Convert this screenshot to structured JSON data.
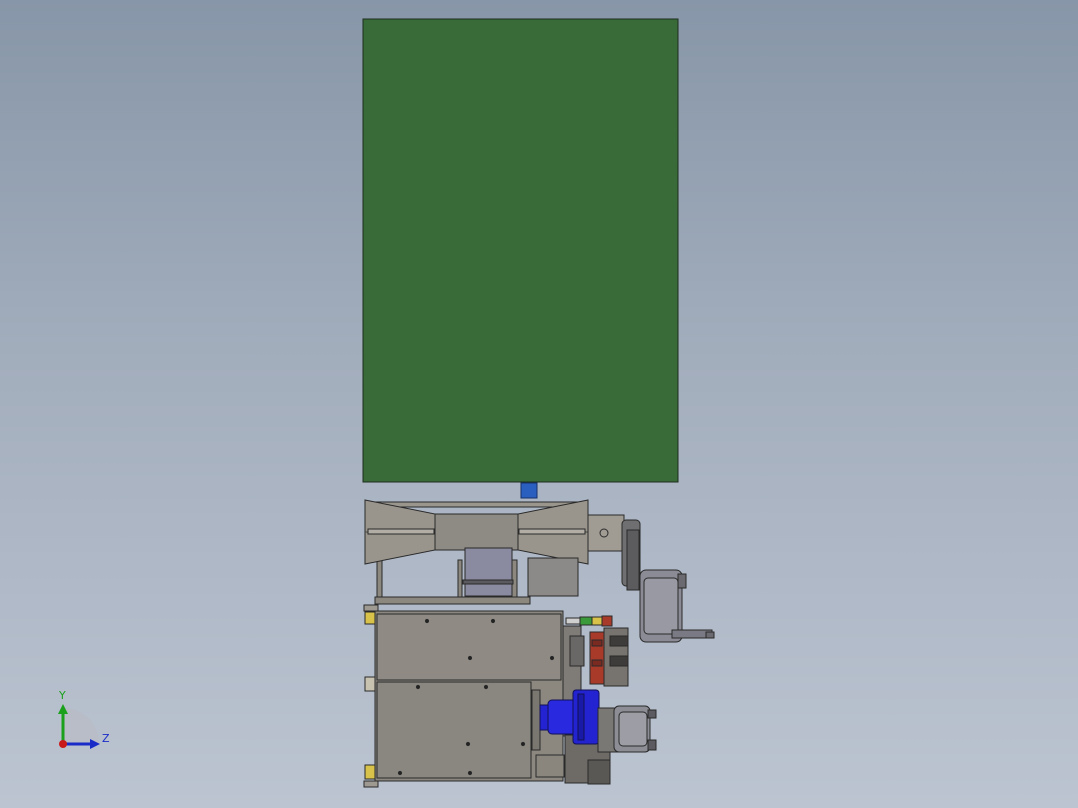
{
  "view": {
    "background_top": "#8796a8",
    "background_bottom": "#bcc4d1"
  },
  "model": {
    "panel_color": "#396b39",
    "metal_color": "#8c8880",
    "motor_color": "#2323d2",
    "accent_blue": "#2b5fbf",
    "accent_red": "#a83a2a",
    "accent_green": "#3a9a3a",
    "accent_yellow": "#d8c24a"
  },
  "triad": {
    "y_label": "Y",
    "z_label": "Z",
    "y_color": "#1aa01a",
    "z_color": "#1a2cc8",
    "x_color": "#c81a1a",
    "icon": "coordinate-triad-icon"
  }
}
